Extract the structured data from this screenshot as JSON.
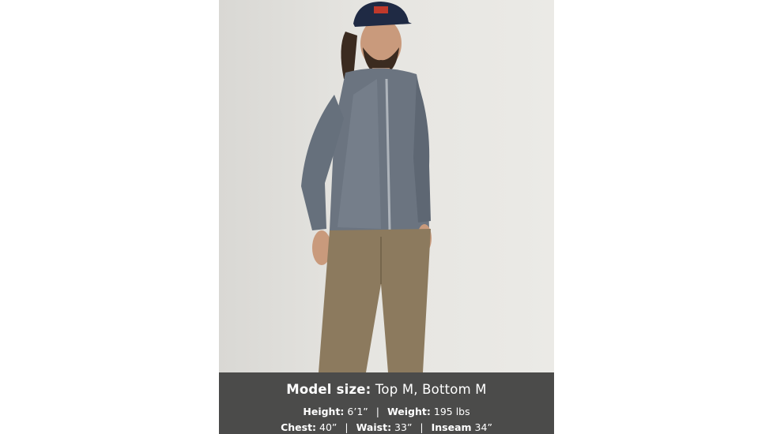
{
  "image": {
    "subject": "model-wearing-grey-jacket",
    "colors": {
      "background": "#e6e5e1",
      "jacket": "#6b7480",
      "pants": "#8c7a5e",
      "cap": "#1f2a44",
      "caption_band": "#4b4b4a",
      "caption_text": "#ffffff"
    }
  },
  "caption": {
    "title_label": "Model size:",
    "title_value": " Top M, Bottom M",
    "height_label": "Height:",
    "height_value": " 6’1”",
    "weight_label": "Weight:",
    "weight_value": " 195 lbs",
    "chest_label": "Chest:",
    "chest_value": " 40”",
    "waist_label": "Waist:",
    "waist_value": " 33”",
    "inseam_label": "Inseam",
    "inseam_value": " 34”",
    "separator": "|"
  }
}
